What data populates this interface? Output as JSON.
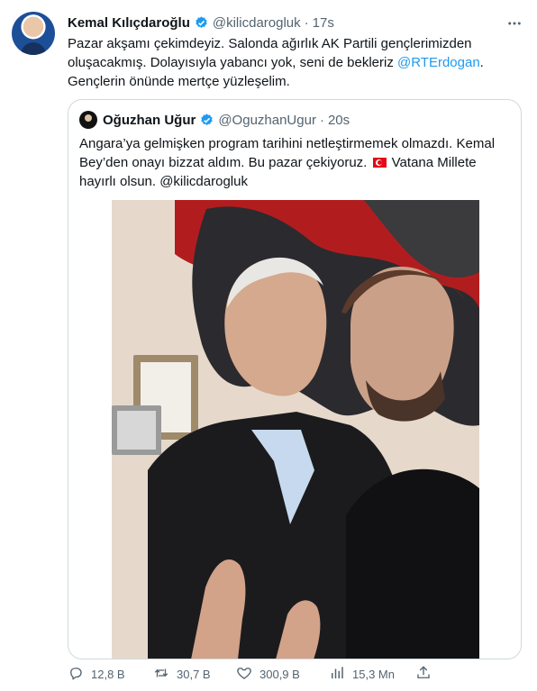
{
  "tweet": {
    "author_name": "Kemal Kılıçdaroğlu",
    "handle": "@kilicdarogluk",
    "separator": "·",
    "time": "17s",
    "text_before_mention": "Pazar akşamı çekimdeyiz. Salonda ağırlık AK Partili gençlerimizden\noluşacakmış. Dolayısıyla yabancı yok, seni de bekleriz ",
    "mention": "@RTErdogan",
    "text_after_mention": ".\nGençlerin önünde mertçe yüzleşelim."
  },
  "quote": {
    "author_name": "Oğuzhan Uğur",
    "handle": "@OguzhanUgur",
    "separator": "·",
    "time": "20s",
    "text_part1": "Angara’ya gelmişken program tarihini netleştirmemek olmazdı. Kemal\nBey’den onayı bizzat aldım. Bu pazar çekiyoruz. ",
    "text_part2": " Vatana Millete\nhayırlı olsun. @kilicdarogluk"
  },
  "actions": {
    "replies": "12,8 B",
    "retweets": "30,7 B",
    "likes": "300,9 B",
    "views": "15,3 Mn"
  },
  "icons": {
    "verified": "verified-badge-icon",
    "more": "more-icon",
    "reply": "reply-icon",
    "retweet": "retweet-icon",
    "like": "like-icon",
    "views": "views-icon",
    "share": "share-icon"
  },
  "colors": {
    "link": "#1d9bf0",
    "muted": "#536471",
    "verified": "#1d9bf0",
    "border": "#cfd9de"
  }
}
